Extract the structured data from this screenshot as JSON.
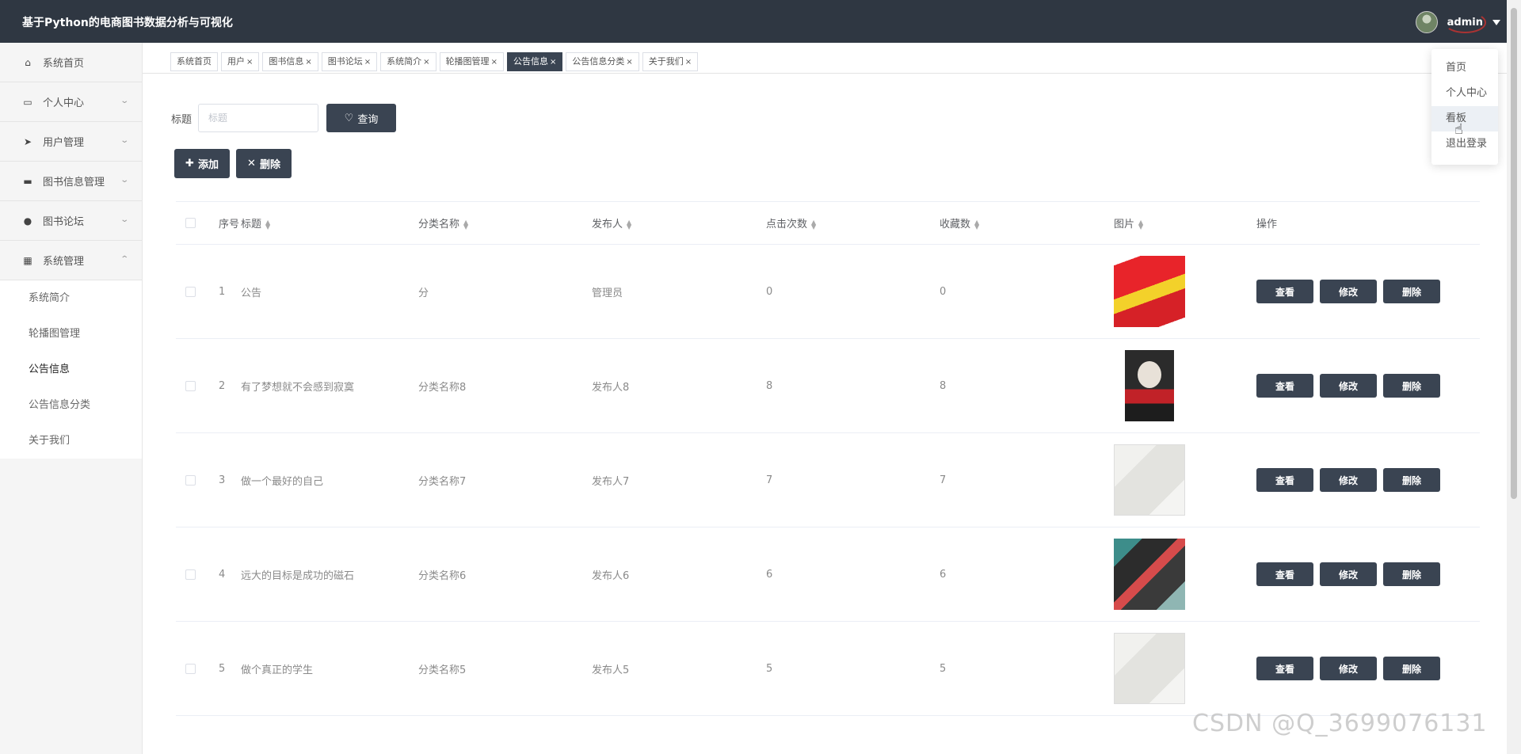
{
  "app": {
    "title": "基于Python的电商图书数据分析与可视化",
    "user": "admin"
  },
  "sidebar": {
    "items": [
      {
        "label": "系统首页",
        "icon": "home-icon"
      },
      {
        "label": "个人中心",
        "icon": "profile-icon"
      },
      {
        "label": "用户管理",
        "icon": "send-icon"
      },
      {
        "label": "图书信息管理",
        "icon": "monitor-icon"
      },
      {
        "label": "图书论坛",
        "icon": "user-icon"
      },
      {
        "label": "系统管理",
        "icon": "grid-icon"
      }
    ],
    "subitems": [
      "系统简介",
      "轮播图管理",
      "公告信息",
      "公告信息分类",
      "关于我们"
    ]
  },
  "tabs": [
    {
      "label": "系统首页",
      "closable": false
    },
    {
      "label": "用户",
      "closable": true
    },
    {
      "label": "图书信息",
      "closable": true
    },
    {
      "label": "图书论坛",
      "closable": true
    },
    {
      "label": "系统简介",
      "closable": true
    },
    {
      "label": "轮播图管理",
      "closable": true
    },
    {
      "label": "公告信息",
      "closable": true,
      "active": true
    },
    {
      "label": "公告信息分类",
      "closable": true
    },
    {
      "label": "关于我们",
      "closable": true
    }
  ],
  "search": {
    "label": "标题",
    "placeholder": "标题",
    "button": "查询"
  },
  "actions": {
    "add": "添加",
    "delete": "删除"
  },
  "table": {
    "headers": [
      "序号",
      "标题",
      "分类名称",
      "发布人",
      "点击次数",
      "收藏数",
      "图片",
      "操作"
    ],
    "rows": [
      {
        "idx": "1",
        "title": "公告",
        "category": "分",
        "publisher": "管理员",
        "clicks": "0",
        "favorites": "0",
        "image": "red-book-stack"
      },
      {
        "idx": "2",
        "title": "有了梦想就不会感到寂寞",
        "category": "分类名称8",
        "publisher": "发布人8",
        "clicks": "8",
        "favorites": "8",
        "image": "portrait-book-cover"
      },
      {
        "idx": "3",
        "title": "做一个最好的自己",
        "category": "分类名称7",
        "publisher": "发布人7",
        "clicks": "7",
        "favorites": "7",
        "image": "white-book-cover"
      },
      {
        "idx": "4",
        "title": "远大的目标是成功的磁石",
        "category": "分类名称6",
        "publisher": "发布人6",
        "clicks": "6",
        "favorites": "6",
        "image": "group-book-cover"
      },
      {
        "idx": "5",
        "title": "做个真正的学生",
        "category": "分类名称5",
        "publisher": "发布人5",
        "clicks": "5",
        "favorites": "5",
        "image": "white-book-cover"
      }
    ],
    "ops": {
      "view": "查看",
      "edit": "修改",
      "delete": "删除"
    }
  },
  "dropdown": {
    "items": [
      "首页",
      "个人中心",
      "看板",
      "退出登录"
    ],
    "hovered": "看板"
  },
  "watermark": "CSDN @Q_3699076131"
}
